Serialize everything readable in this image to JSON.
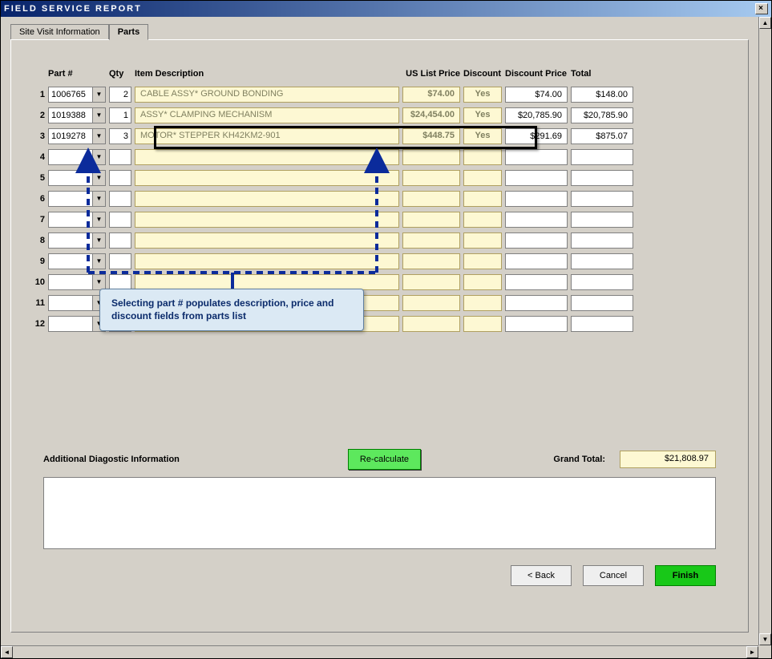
{
  "window": {
    "title": "FIELD SERVICE REPORT"
  },
  "tabs": {
    "site": "Site Visit Information",
    "parts": "Parts"
  },
  "headers": {
    "part": "Part #",
    "qty": "Qty",
    "desc": "Item Description",
    "price": "US List Price",
    "discount": "Discount",
    "dprice": "Discount Price",
    "total": "Total"
  },
  "rows": [
    {
      "n": "1",
      "part": "1006765",
      "qty": "2",
      "desc": "CABLE ASSY* GROUND BONDING",
      "price": "$74.00",
      "discount": "Yes",
      "dprice": "$74.00",
      "total": "$148.00"
    },
    {
      "n": "2",
      "part": "1019388",
      "qty": "1",
      "desc": "ASSY* CLAMPING MECHANISM",
      "price": "$24,454.00",
      "discount": "Yes",
      "dprice": "$20,785.90",
      "total": "$20,785.90"
    },
    {
      "n": "3",
      "part": "1019278",
      "qty": "3",
      "desc": "MOTOR* STEPPER KH42KM2-901",
      "price": "$448.75",
      "discount": "Yes",
      "dprice": "$291.69",
      "total": "$875.07"
    },
    {
      "n": "4",
      "part": "",
      "qty": "",
      "desc": "",
      "price": "",
      "discount": "",
      "dprice": "",
      "total": ""
    },
    {
      "n": "5",
      "part": "",
      "qty": "",
      "desc": "",
      "price": "",
      "discount": "",
      "dprice": "",
      "total": ""
    },
    {
      "n": "6",
      "part": "",
      "qty": "",
      "desc": "",
      "price": "",
      "discount": "",
      "dprice": "",
      "total": ""
    },
    {
      "n": "7",
      "part": "",
      "qty": "",
      "desc": "",
      "price": "",
      "discount": "",
      "dprice": "",
      "total": ""
    },
    {
      "n": "8",
      "part": "",
      "qty": "",
      "desc": "",
      "price": "",
      "discount": "",
      "dprice": "",
      "total": ""
    },
    {
      "n": "9",
      "part": "",
      "qty": "",
      "desc": "",
      "price": "",
      "discount": "",
      "dprice": "",
      "total": ""
    },
    {
      "n": "10",
      "part": "",
      "qty": "",
      "desc": "",
      "price": "",
      "discount": "",
      "dprice": "",
      "total": ""
    },
    {
      "n": "11",
      "part": "",
      "qty": "",
      "desc": "",
      "price": "",
      "discount": "",
      "dprice": "",
      "total": ""
    },
    {
      "n": "12",
      "part": "",
      "qty": "",
      "desc": "",
      "price": "",
      "discount": "",
      "dprice": "",
      "total": ""
    }
  ],
  "callout": "Selecting part # populates description, price and discount fields from parts list",
  "footer": {
    "recalc": "Re-calculate",
    "diag_label": "Additional Diagostic Information",
    "gt_label": "Grand Total:",
    "gt_value": "$21,808.97",
    "back": "< Back",
    "cancel": "Cancel",
    "finish": "Finish"
  }
}
